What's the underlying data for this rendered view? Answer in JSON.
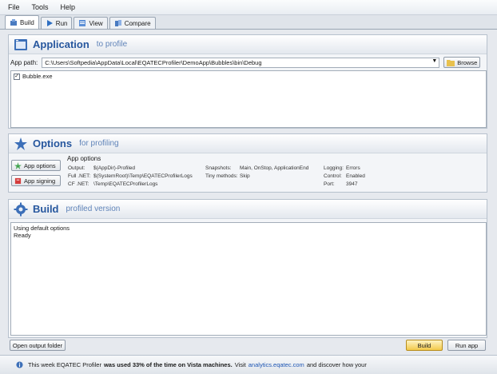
{
  "menu": {
    "items": [
      {
        "label": "File"
      },
      {
        "label": "Tools"
      },
      {
        "label": "Help"
      }
    ]
  },
  "tabs": [
    {
      "label": "Build",
      "icon": "build-icon",
      "active": true
    },
    {
      "label": "Run",
      "icon": "run-icon",
      "active": false
    },
    {
      "label": "View",
      "icon": "view-icon",
      "active": false
    },
    {
      "label": "Compare",
      "icon": "compare-icon",
      "active": false
    }
  ],
  "application": {
    "title": "Application",
    "subtitle": "to profile",
    "app_path_label": "App path:",
    "app_path_value": "C:\\Users\\Softpedia\\AppData\\Local\\EQATECProfiler\\DemoApp\\Bubbles\\bin\\Debug",
    "browse_label": "Browse",
    "files": [
      {
        "name": "Bubble.exe",
        "checked": true
      }
    ]
  },
  "options": {
    "title": "Options",
    "subtitle": "for profiling",
    "app_options_button": "App options",
    "app_signing_button": "App signing",
    "section_title": "App options",
    "col1": [
      {
        "key": "Output:",
        "value": "$(AppDir)-Profiled"
      },
      {
        "key": "Full .NET:",
        "value": "$(SystemRoot)\\Temp\\EQATECProfilerLogs"
      },
      {
        "key": "CF .NET:",
        "value": "\\Temp\\EQATECProfilerLogs"
      }
    ],
    "col2": [
      {
        "key": "Snapshots:",
        "value": "Main, OnStop, ApplicationEnd"
      },
      {
        "key": "Tiny methods:",
        "value": "Skip"
      }
    ],
    "col3": [
      {
        "key": "Logging:",
        "value": "Errors"
      },
      {
        "key": "Control:",
        "value": "Enabled"
      },
      {
        "key": "Port:",
        "value": "3947"
      }
    ]
  },
  "build": {
    "title": "Build",
    "subtitle": "profiled version",
    "log_lines": [
      "Using default options",
      "Ready"
    ],
    "open_output_label": "Open output folder",
    "build_button": "Build",
    "run_app_button": "Run app"
  },
  "status": {
    "prefix": "This week EQATEC Profiler",
    "bold_text": "was used 33% of the time on Vista machines.",
    "visit": "Visit",
    "link": "analytics.eqatec.com",
    "suffix": "and discover how your"
  },
  "colors": {
    "accent": "#27579e",
    "build_button": "#f2c94a"
  }
}
